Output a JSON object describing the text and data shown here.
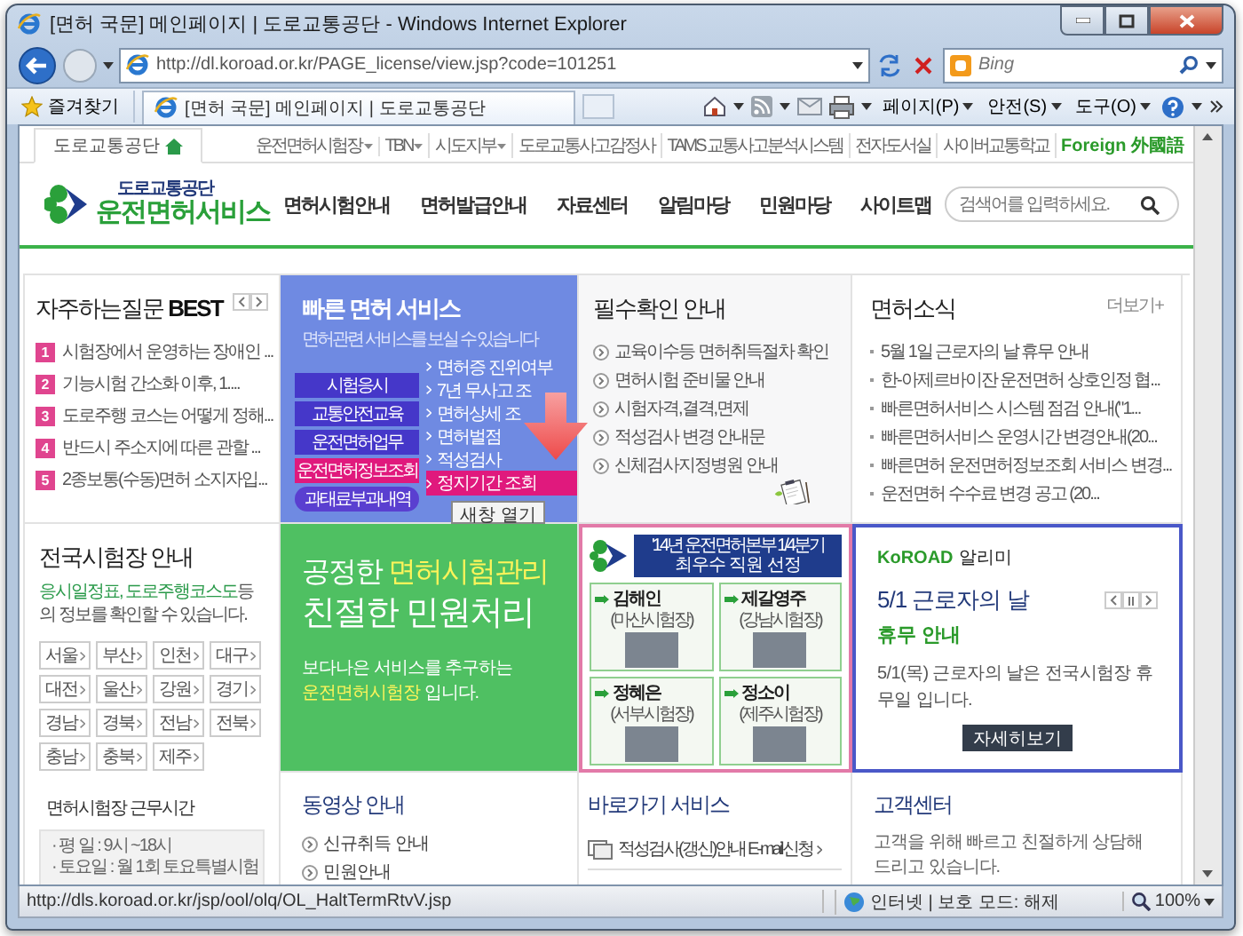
{
  "window": {
    "title": "[면허 국문] 메인페이지 | 도로교통공단 - Windows Internet Explorer"
  },
  "navigation": {
    "url": "http://dl.koroad.or.kr/PAGE_license/view.jsp?code=101251",
    "search_placeholder": "Bing"
  },
  "favorites": "즐겨찾기",
  "tabs": [
    {
      "label": "[면허 국문] 메인페이지 | 도로교통공단",
      "selected": true
    }
  ],
  "commands": [
    "페이지(P)",
    "안전(S)",
    "도구(O)"
  ],
  "page": {
    "utility_bar": {
      "home": "도로교통공단",
      "links": [
        {
          "label": "운전면허시험장",
          "dropdown": true,
          "kind": "link"
        },
        {
          "label": "TBN",
          "dropdown": true,
          "kind": "link"
        },
        {
          "label": "시도지부",
          "dropdown": true,
          "kind": "link"
        },
        {
          "label": "도로교통사고감정사",
          "dropdown": false,
          "kind": "link"
        },
        {
          "label": "TAMS 교통사고분석시스템",
          "dropdown": false,
          "kind": "link"
        },
        {
          "label": "전자도서실",
          "dropdown": false,
          "kind": "link"
        },
        {
          "label": "사이버교통학교",
          "dropdown": false,
          "kind": "link"
        },
        {
          "label": "Foreign 外國語",
          "dropdown": false,
          "kind": "foreign"
        }
      ]
    },
    "logo": {
      "org": "도로교통공단",
      "service": "운전면허서비스"
    },
    "menu": [
      "면허시험안내",
      "면허발급안내",
      "자료센터",
      "알림마당",
      "민원마당",
      "사이트맵"
    ],
    "site_search": {
      "placeholder": "검색어를 입력하세요."
    },
    "faq": {
      "title": "자주하는질문 **BEST**",
      "items": [
        {
          "rank": "1",
          "text": "시험장에서 운영하는 장애인 ..."
        },
        {
          "rank": "2",
          "text": "기능시험 간소화 이후, 1...."
        },
        {
          "rank": "3",
          "text": "도로주행 코스는 어떻게 정해..."
        },
        {
          "rank": "4",
          "text": "반드시 주소지에 따른 관할 ..."
        },
        {
          "rank": "5",
          "text": "2종보통(수동)면허 소지자입..."
        }
      ]
    },
    "quick_service": {
      "title": "빠른 면허 서비스",
      "subtitle": "면허관련 서비스를 보실 수 있습니다",
      "buttons": [
        {
          "label": "시험응시",
          "selected": false,
          "kind": "box"
        },
        {
          "label": "교통안전교육",
          "selected": false,
          "kind": "box"
        },
        {
          "label": "운전면허업무",
          "selected": false,
          "kind": "box"
        },
        {
          "label": "운전면허정보조회",
          "selected": true,
          "kind": "box"
        },
        {
          "label": "과태료부과내역",
          "selected": false,
          "kind": "oval"
        }
      ],
      "links": [
        {
          "label": "면허증 진위여부",
          "selected": false
        },
        {
          "label": "7년 무사고 조",
          "selected": false
        },
        {
          "label": "면허상세 조",
          "selected": false
        },
        {
          "label": "면허벌점",
          "selected": false
        },
        {
          "label": "적성검사",
          "selected": false
        },
        {
          "label": "정지기간 조회",
          "selected": true
        }
      ],
      "popup_button": "새창 열기"
    },
    "guide": {
      "title": "필수확인 안내",
      "items": [
        "교육이수등 면허취득절차 확인",
        "면허시험 준비물 안내",
        "시험자격,결격,면제",
        "적성검사 변경 안내문",
        "신체검사지정병원 안내"
      ]
    },
    "news": {
      "title": "면허소식",
      "more": "더보기+",
      "items": [
        "5월 1일 근로자의 날 휴무 안내",
        "한-아제르바이잔 운전면허 상호인정 협...",
        "빠른면허서비스 시스템 점검 안내(\"1...",
        "빠른면허서비스 운영시간 변경안내(20...",
        "빠른면허 운전면허정보조회 서비스 변경...",
        "운전면허 수수료 변경 공고 (20..."
      ]
    },
    "test_centers": {
      "title": "전국시험장 안내",
      "description": "**응시일정표, 도로주행코스도**등의 정보를 확인할 수 있습니다.",
      "regions": [
        "서울",
        "부산",
        "인천",
        "대구",
        "대전",
        "울산",
        "강원",
        "경기",
        "경남",
        "경북",
        "전남",
        "전북",
        "충남",
        "충북",
        "제주"
      ]
    },
    "banner": {
      "headline": "공정한 **면허시험관리**",
      "headline2": "친절한 민원처리",
      "text": "보다나은 서비스를 추구하는",
      "text2": "**운전면허시험장** 입니다."
    },
    "staff": {
      "period": "'14년 운전면허본부 1/4분기",
      "title": "최우수 직원 선정",
      "people": [
        {
          "name": "김해인",
          "office": "(마산시험장)"
        },
        {
          "name": "제갈영주",
          "office": "(강남시험장)"
        },
        {
          "name": "정혜은",
          "office": "(서부시험장)"
        },
        {
          "name": "정소이",
          "office": "(제주시험장)"
        }
      ]
    },
    "alert": {
      "brand": "KoROAD",
      "title": "알리미",
      "headline": "5/1 근로자의 날",
      "subhead": "휴무 안내",
      "body": "5/1(목) 근로자의 날은 전국시험장 휴무일 입니다.",
      "button": "자세히보기"
    },
    "hours": {
      "title": "면허시험장 근무시간",
      "lines": [
        "· 평 일 : 9시 ~18시",
        "· 토요일 : 월 1회 토요특별시험"
      ]
    },
    "video": {
      "title": "동영상 안내",
      "items": [
        "신규취득 안내",
        "민원안내"
      ]
    },
    "shortcuts": {
      "title": "바로가기 서비스",
      "items": [
        "적성검사(갱신)안내 E-mail신청"
      ]
    },
    "support": {
      "title": "고객센터",
      "text": "고객을 위해 빠르고 친절하게 상담해 드리고 있습니다."
    }
  },
  "status_bar": {
    "url": "http://dls.koroad.or.kr/jsp/ool/olq/OL_HaltTermRtvV.jsp",
    "zone": "인터넷 | 보호 모드: 해제",
    "zoom": "100%"
  }
}
